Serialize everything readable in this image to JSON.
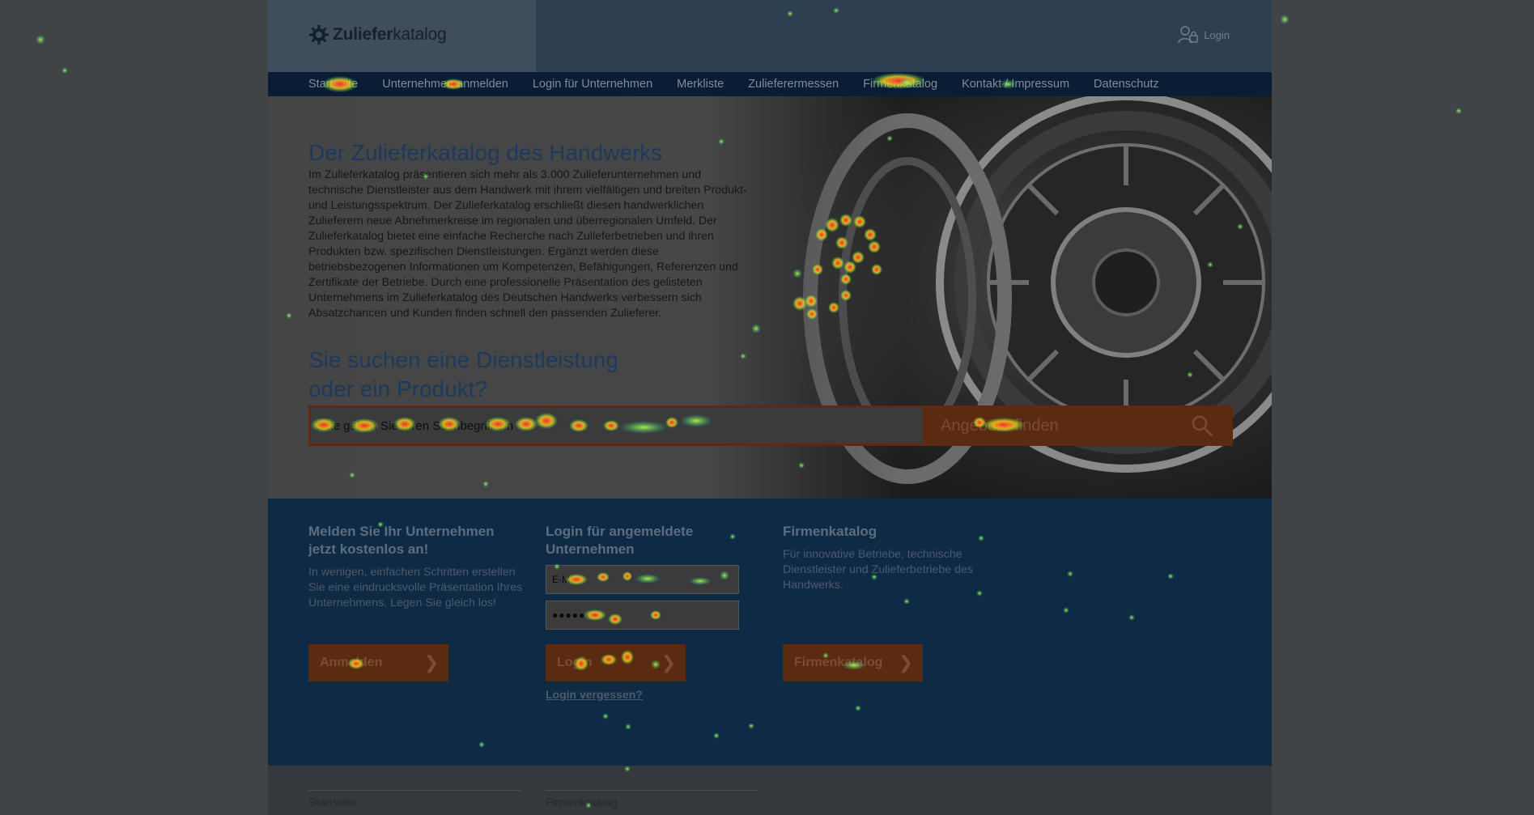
{
  "header": {
    "logo_strong": "Zuliefer",
    "logo_rest": "katalog",
    "login_label": "Login"
  },
  "nav": {
    "items": [
      "Startseite",
      "Unternehmen anmelden",
      "Login für Unternehmen",
      "Merkliste",
      "Zulieferermessen",
      "Firmenkatalog",
      "Kontakt / Impressum",
      "Datenschutz"
    ]
  },
  "hero": {
    "title": "Der Zulieferkatalog des Handwerks",
    "text": "Im Zulieferkatalog präsentieren sich mehr als 3.000 Zulieferunternehmen und technische Dienstleister aus dem Handwerk mit ihrem vielfältigen und breiten Produkt- und Leistungsspektrum. Der Zulieferkatalog erschließt diesen handwerklichen Zulieferern neue Abnehmerkreise im regionalen und überregionalen Umfeld. Der Zulieferkatalog bietet eine einfache Recherche nach Zulieferbetrieben und ihren Produkten bzw. spezifischen Dienstleistungen. Ergänzt werden diese betriebsbezogenen Informationen um Kompetenzen, Befähigungen, Referenzen und Zertifikate der Betriebe. Durch eine professionelle Präsentation des gelisteten Unternehmens im Zulieferkatalog des Deutschen Handwerks verbessern sich Absatzchancen und Kunden finden schnell den passenden Zulieferer.",
    "search_title_line1": "Sie suchen eine Dienstleistung",
    "search_title_line2": "oder ein Produkt?",
    "search_placeholder": "Bitte geben Sie Ihren Suchbegriff ein",
    "search_button": "Angebote finden"
  },
  "register": {
    "title": "Melden Sie Ihr Unternehmen jetzt kostenlos an!",
    "text": "In wenigen, einfachen Schritten erstellen Sie eine eindrucksvolle Präsentation Ihres Unternehmens. Legen Sie gleich los!",
    "button": "Anmelden"
  },
  "login": {
    "title": "Login für angemeldete Unternehmen",
    "email_placeholder": "E-Mail",
    "password_value": "●●●●●●●",
    "button": "Login",
    "forgot": "Login vergessen?"
  },
  "catalog": {
    "title": "Firmenkatalog",
    "text": "Für innovative Betriebe, technische Dienstleister und Zulieferbetriebe des Handwerks.",
    "button": "Firmenkatalog"
  },
  "footer": {
    "col1": "Startseite",
    "col2": "Firmenkatalog"
  },
  "colors": {
    "accent": "#5a2b10",
    "nav_bg": "#0b1d34",
    "section_bg": "#0f2a45"
  }
}
